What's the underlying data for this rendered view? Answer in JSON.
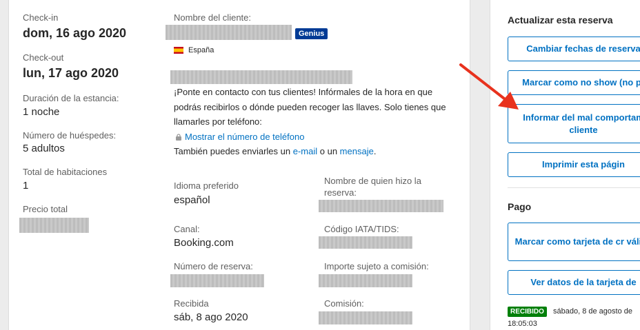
{
  "stay": {
    "checkin_label": "Check-in",
    "checkin_value": "dom, 16 ago 2020",
    "checkout_label": "Check-out",
    "checkout_value": "lun, 17 ago 2020",
    "duration_label": "Duración de la estancia:",
    "duration_value": "1 noche",
    "guests_label": "Número de huéspedes:",
    "guests_value": "5 adultos",
    "rooms_label": "Total de habitaciones",
    "rooms_value": "1",
    "price_label": "Precio total"
  },
  "guest": {
    "name_label": "Nombre del cliente:",
    "genius_badge": "Genius",
    "country": "España",
    "contact_text": "¡Ponte en contacto con tus clientes! Infórmales de la hora en que podrás recibirlos o dónde pueden recoger las llaves. Solo tienes que llamarles por teléfono:",
    "show_phone_link": "Mostrar el número de teléfono",
    "send_prefix": "También puedes enviarles un ",
    "email_link": "e-mail",
    "send_middle": " o un ",
    "message_link": "mensaje",
    "send_suffix": "."
  },
  "details": {
    "language_label": "Idioma preferido",
    "language_value": "español",
    "booker_label": "Nombre de quien hizo la reserva:",
    "channel_label": "Canal:",
    "channel_value": "Booking.com",
    "iata_label": "Código IATA/TIDS:",
    "booking_number_label": "Número de reserva:",
    "commission_amount_label": "Importe sujeto a comisión:",
    "received_label": "Recibida",
    "received_value": "sáb, 8 ago 2020",
    "commission_label": "Comisión:"
  },
  "sidebar": {
    "update_title": "Actualizar esta reserva",
    "change_dates_button": "Cambiar fechas de reserva",
    "no_show_button": "Marcar como no show (no pr",
    "report_button": "Informar del mal comportam cliente",
    "print_button": "Imprimir esta págin",
    "payment_title": "Pago",
    "card_invalid_button": "Marcar como tarjeta de cr válida",
    "view_card_button": "Ver datos de la tarjeta de",
    "received_badge": "RECIBIDO",
    "received_date": "sábado, 8 de agosto de",
    "received_time": "18:05:03"
  },
  "colors": {
    "link": "#0071c2",
    "genius": "#003b95",
    "badge_green": "#008009",
    "arrow_red": "#e8321e"
  }
}
